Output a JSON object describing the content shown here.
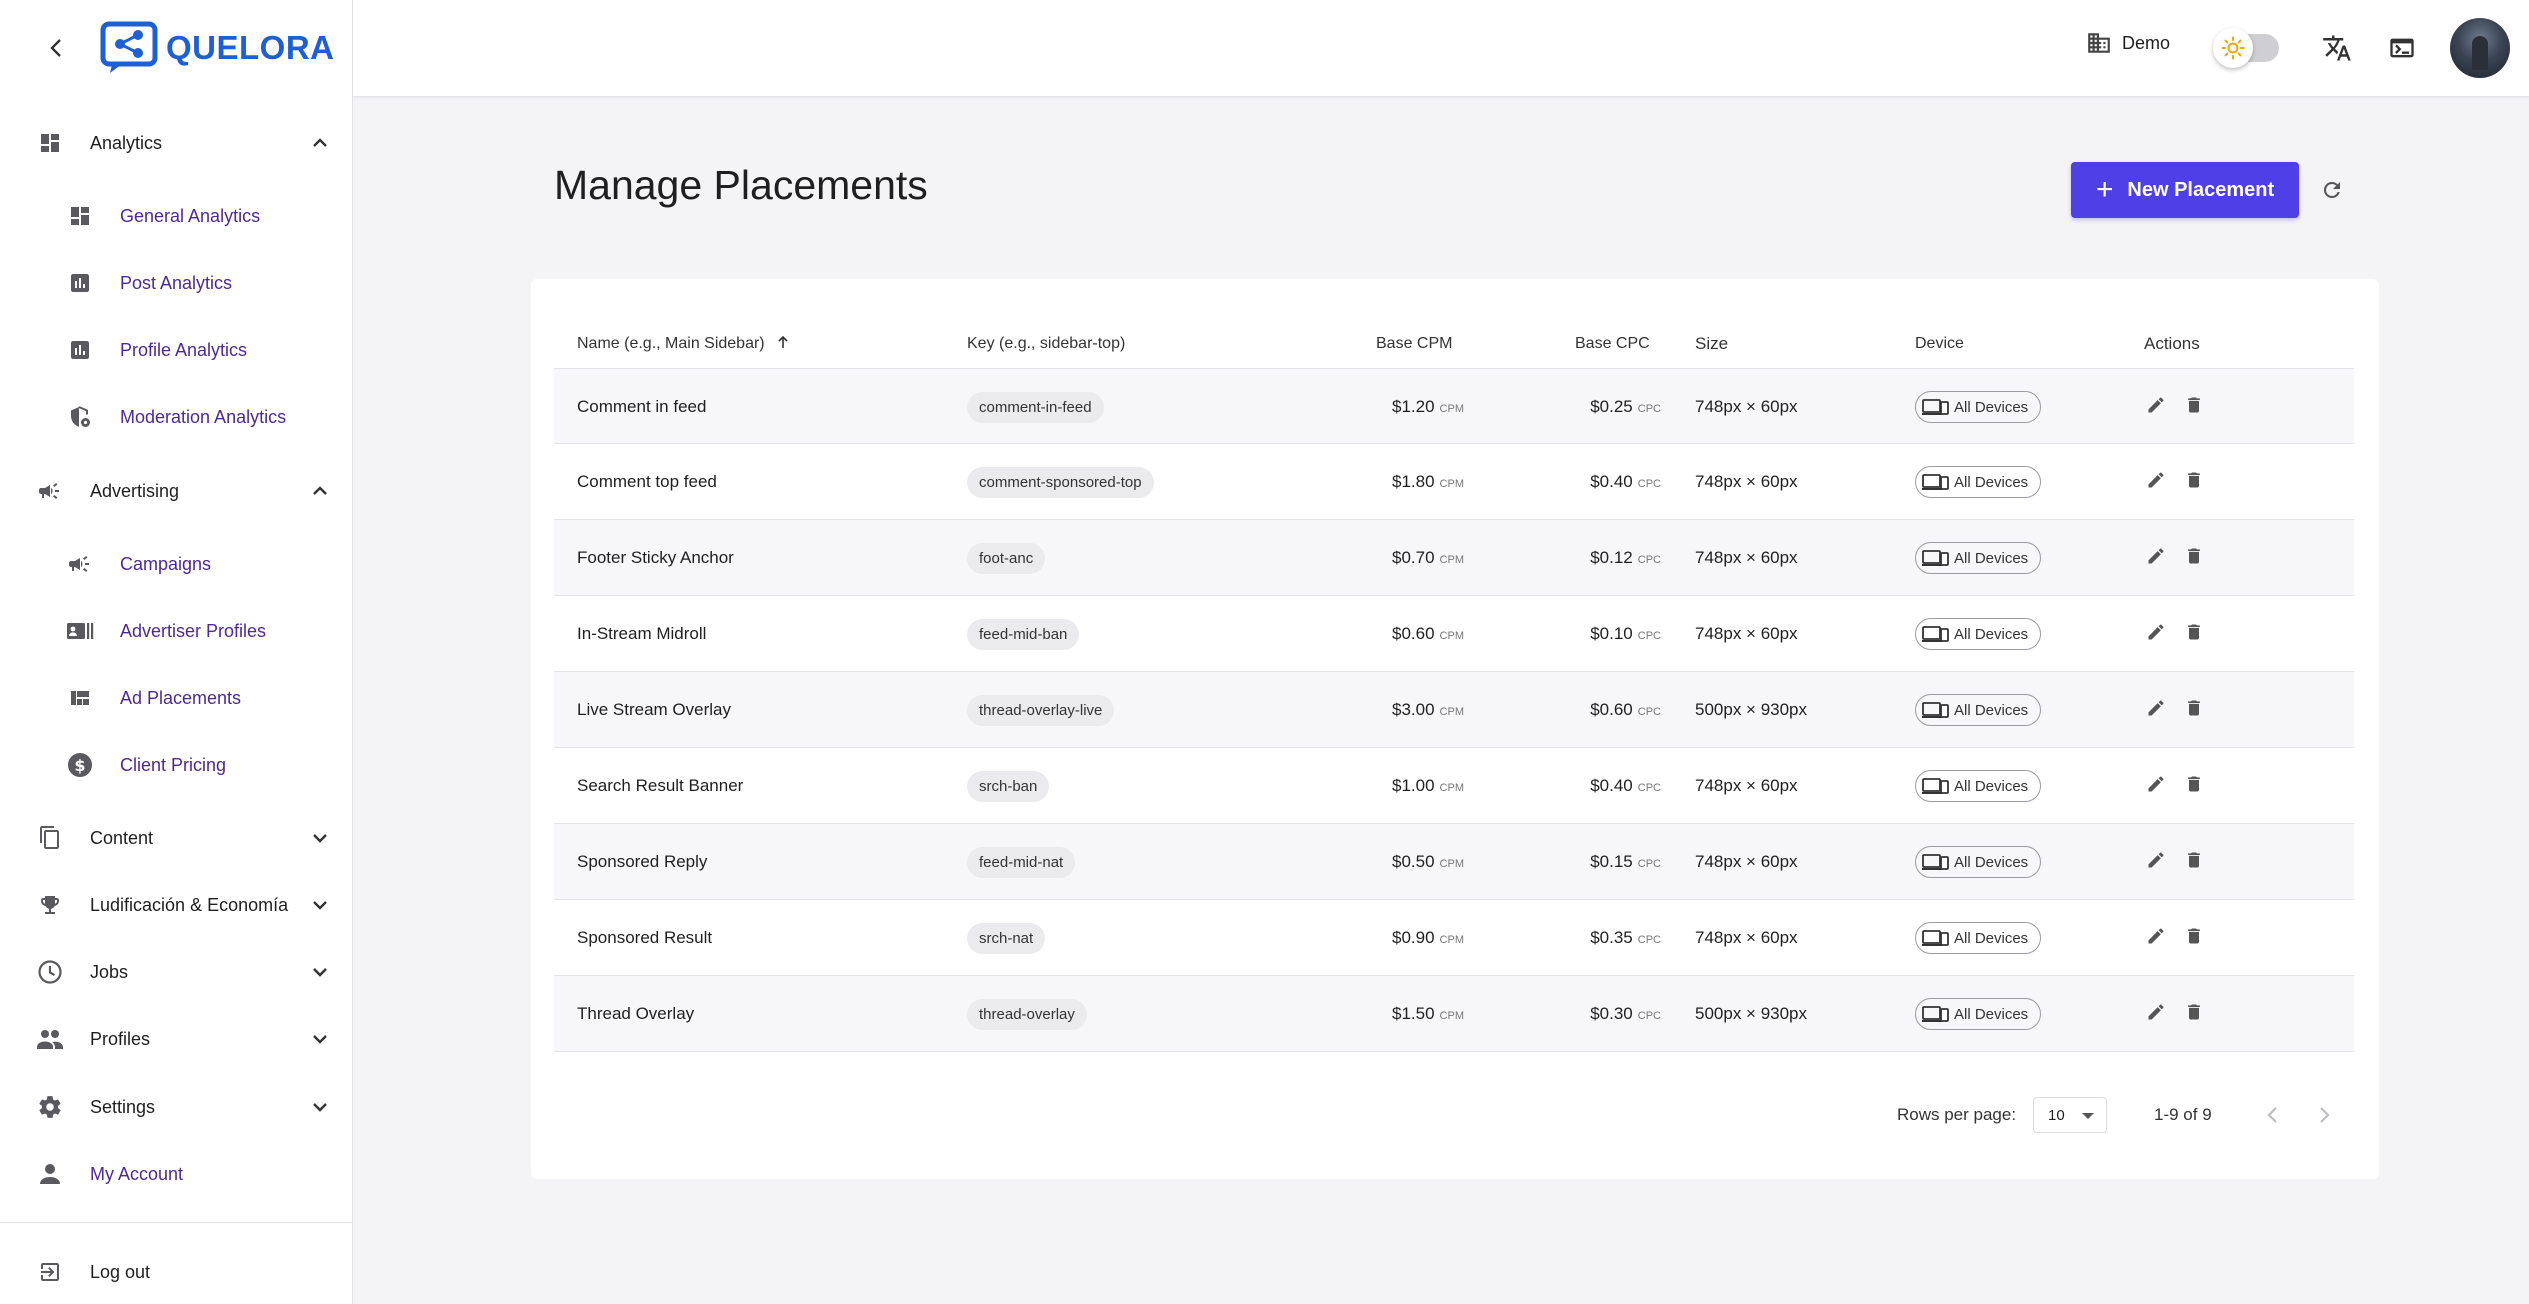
{
  "brand": {
    "name": "QUELORA",
    "color": "#1f5fd6"
  },
  "sidebar": {
    "sections": [
      {
        "label": "Analytics",
        "icon": "dashboard-icon",
        "expanded": true
      },
      {
        "label": "Advertising",
        "icon": "campaign-icon",
        "expanded": true
      },
      {
        "label": "Content",
        "icon": "content-icon",
        "expanded": false
      },
      {
        "label": "Ludificación & Economía",
        "icon": "trophy-icon",
        "expanded": false
      },
      {
        "label": "Jobs",
        "icon": "clock-icon",
        "expanded": false
      },
      {
        "label": "Profiles",
        "icon": "people-icon",
        "expanded": false
      },
      {
        "label": "Settings",
        "icon": "gear-icon",
        "expanded": false
      }
    ],
    "analytics_items": [
      {
        "label": "General Analytics",
        "icon": "dashboard-icon"
      },
      {
        "label": "Post Analytics",
        "icon": "bar-chart-icon"
      },
      {
        "label": "Profile Analytics",
        "icon": "bar-chart-icon"
      },
      {
        "label": "Moderation Analytics",
        "icon": "shield-icon"
      }
    ],
    "advertising_items": [
      {
        "label": "Campaigns",
        "icon": "campaign-icon"
      },
      {
        "label": "Advertiser Profiles",
        "icon": "contact-card-icon"
      },
      {
        "label": "Ad Placements",
        "icon": "layout-icon"
      },
      {
        "label": "Client Pricing",
        "icon": "dollar-icon"
      }
    ],
    "my_account": "My Account",
    "logout": "Log out"
  },
  "topbar": {
    "tenant": "Demo",
    "theme_toggle": "light"
  },
  "page": {
    "title": "Manage Placements",
    "new_button": "New Placement",
    "accent": "#4f3fe6"
  },
  "table": {
    "columns": {
      "name": "Name (e.g., Main Sidebar)",
      "key": "Key (e.g., sidebar-top)",
      "cpm": "Base CPM",
      "cpc": "Base CPC",
      "size": "Size",
      "device": "Device",
      "actions": "Actions"
    },
    "sort": "name-ascending",
    "rows": [
      {
        "name": "Comment in feed",
        "key": "comment-in-feed",
        "cpm": "$1.20",
        "cpm_unit": "CPM",
        "cpc": "$0.25",
        "cpc_unit": "CPC",
        "size": "748px × 60px",
        "device": "All Devices"
      },
      {
        "name": "Comment top feed",
        "key": "comment-sponsored-top",
        "cpm": "$1.80",
        "cpm_unit": "CPM",
        "cpc": "$0.40",
        "cpc_unit": "CPC",
        "size": "748px × 60px",
        "device": "All Devices"
      },
      {
        "name": "Footer Sticky Anchor",
        "key": "foot-anc",
        "cpm": "$0.70",
        "cpm_unit": "CPM",
        "cpc": "$0.12",
        "cpc_unit": "CPC",
        "size": "748px × 60px",
        "device": "All Devices"
      },
      {
        "name": "In-Stream Midroll",
        "key": "feed-mid-ban",
        "cpm": "$0.60",
        "cpm_unit": "CPM",
        "cpc": "$0.10",
        "cpc_unit": "CPC",
        "size": "748px × 60px",
        "device": "All Devices"
      },
      {
        "name": "Live Stream Overlay",
        "key": "thread-overlay-live",
        "cpm": "$3.00",
        "cpm_unit": "CPM",
        "cpc": "$0.60",
        "cpc_unit": "CPC",
        "size": "500px × 930px",
        "device": "All Devices"
      },
      {
        "name": "Search Result Banner",
        "key": "srch-ban",
        "cpm": "$1.00",
        "cpm_unit": "CPM",
        "cpc": "$0.40",
        "cpc_unit": "CPC",
        "size": "748px × 60px",
        "device": "All Devices"
      },
      {
        "name": "Sponsored Reply",
        "key": "feed-mid-nat",
        "cpm": "$0.50",
        "cpm_unit": "CPM",
        "cpc": "$0.15",
        "cpc_unit": "CPC",
        "size": "748px × 60px",
        "device": "All Devices"
      },
      {
        "name": "Sponsored Result",
        "key": "srch-nat",
        "cpm": "$0.90",
        "cpm_unit": "CPM",
        "cpc": "$0.35",
        "cpc_unit": "CPC",
        "size": "748px × 60px",
        "device": "All Devices"
      },
      {
        "name": "Thread Overlay",
        "key": "thread-overlay",
        "cpm": "$1.50",
        "cpm_unit": "CPM",
        "cpc": "$0.30",
        "cpc_unit": "CPC",
        "size": "500px × 930px",
        "device": "All Devices"
      }
    ]
  },
  "pagination": {
    "rows_per_page_label": "Rows per page:",
    "rows_per_page": "10",
    "range": "1-9 of 9"
  }
}
